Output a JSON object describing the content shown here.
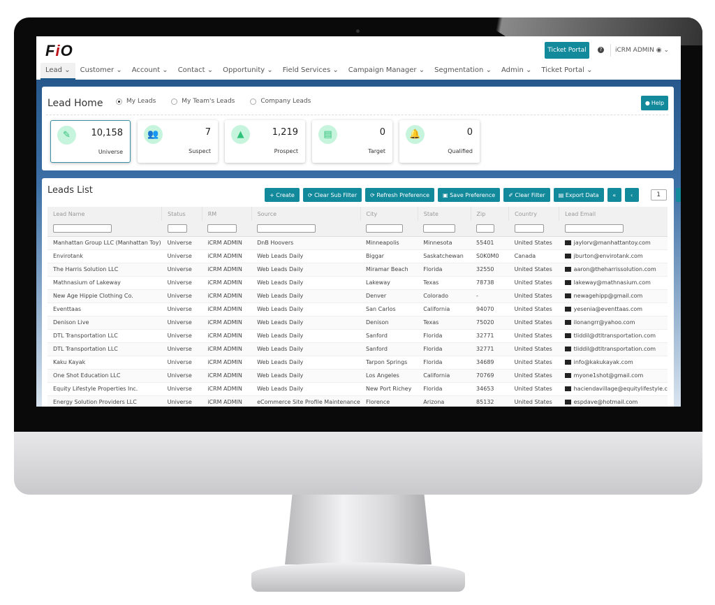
{
  "header": {
    "logo": "FIO",
    "ticket_portal_button": "Ticket Portal",
    "user": "iCRM ADMIN"
  },
  "nav": [
    "Lead",
    "Customer",
    "Account",
    "Contact",
    "Opportunity",
    "Field Services",
    "Campaign Manager",
    "Segmentation",
    "Admin",
    "Ticket Portal"
  ],
  "lead_home": {
    "title": "Lead Home",
    "radios": [
      {
        "label": "My Leads",
        "checked": true
      },
      {
        "label": "My Team's Leads",
        "checked": false
      },
      {
        "label": "Company Leads",
        "checked": false
      }
    ],
    "help": "Help",
    "cards": [
      {
        "value": "10,158",
        "label": "Universe",
        "icon": "ticket-icon",
        "glyph": "✎"
      },
      {
        "value": "7",
        "label": "Suspect",
        "icon": "users-icon",
        "glyph": "👥"
      },
      {
        "value": "1,219",
        "label": "Prospect",
        "icon": "warning-icon",
        "glyph": "▲"
      },
      {
        "value": "0",
        "label": "Target",
        "icon": "document-icon",
        "glyph": "▤"
      },
      {
        "value": "0",
        "label": "Qualified",
        "icon": "bell-icon",
        "glyph": "🔔"
      }
    ]
  },
  "leads_list": {
    "title": "Leads List",
    "buttons": {
      "create": "+ Create",
      "clear_sub_filter": "⟳ Clear Sub Filter",
      "refresh_preference": "⟳ Refresh Preference",
      "save_preference": "▣ Save Preference",
      "clear_filter": "✐ Clear Filter",
      "export_data": "▤ Export Data"
    },
    "page": "1",
    "columns": [
      "Lead Name",
      "Status",
      "RM",
      "Source",
      "City",
      "State",
      "Zip",
      "Country",
      "Lead Email"
    ],
    "rows": [
      [
        "Manhattan Group LLC (Manhattan Toy)",
        "Universe",
        "iCRM ADMIN",
        "DnB Hoovers",
        "Minneapolis",
        "Minnesota",
        "55401",
        "United States",
        "jaylorv@manhattantoy.com"
      ],
      [
        "Envirotank",
        "Universe",
        "iCRM ADMIN",
        "Web Leads Daily",
        "Biggar",
        "Saskatchewan",
        "S0K0M0",
        "Canada",
        "jburton@envirotank.com"
      ],
      [
        "The Harris Solution LLC",
        "Universe",
        "iCRM ADMIN",
        "Web Leads Daily",
        "Miramar Beach",
        "Florida",
        "32550",
        "United States",
        "aaron@theharrissolution.com"
      ],
      [
        "Mathnasium of Lakeway",
        "Universe",
        "iCRM ADMIN",
        "Web Leads Daily",
        "Lakeway",
        "Texas",
        "78738",
        "United States",
        "lakeway@mathnasium.com"
      ],
      [
        "New Age Hippie Clothing Co.",
        "Universe",
        "iCRM ADMIN",
        "Web Leads Daily",
        "Denver",
        "Colorado",
        "-",
        "United States",
        "newagehipp@gmail.com"
      ],
      [
        "Eventtaas",
        "Universe",
        "iCRM ADMIN",
        "Web Leads Daily",
        "San Carlos",
        "California",
        "94070",
        "United States",
        "yesenia@eventtaas.com"
      ],
      [
        "Denison Live",
        "Universe",
        "iCRM ADMIN",
        "Web Leads Daily",
        "Denison",
        "Texas",
        "75020",
        "United States",
        "ilonangrr@yahoo.com"
      ],
      [
        "DTL Transportation LLC",
        "Universe",
        "iCRM ADMIN",
        "Web Leads Daily",
        "Sanford",
        "Florida",
        "32771",
        "United States",
        "tliddil@dtltransportation.com"
      ],
      [
        "DTL Transportation LLC",
        "Universe",
        "iCRM ADMIN",
        "Web Leads Daily",
        "Sanford",
        "Florida",
        "32771",
        "United States",
        "tliddil@dtltransportation.com"
      ],
      [
        "Kaku Kayak",
        "Universe",
        "iCRM ADMIN",
        "Web Leads Daily",
        "Tarpon Springs",
        "Florida",
        "34689",
        "United States",
        "info@kakukayak.com"
      ],
      [
        "One Shot Education LLC",
        "Universe",
        "iCRM ADMIN",
        "Web Leads Daily",
        "Los Angeles",
        "California",
        "70769",
        "United States",
        "myone1shot@gmail.com"
      ],
      [
        "Equity Lifestyle Properties Inc.",
        "Universe",
        "iCRM ADMIN",
        "Web Leads Daily",
        "New Port Richey",
        "Florida",
        "34653",
        "United States",
        "haciendavillage@equitylifestyle.c"
      ],
      [
        "Energy Solution Providers LLC",
        "Universe",
        "iCRM ADMIN",
        "eCommerce Site Profile Maintenance",
        "Florence",
        "Arizona",
        "85132",
        "United States",
        "espdave@hotmail.com"
      ]
    ]
  },
  "colors": {
    "accent": "#138a9c",
    "link": "#2f7fb5",
    "card_icon_bg": "#c6f4dc",
    "card_icon": "#2fc27a"
  }
}
